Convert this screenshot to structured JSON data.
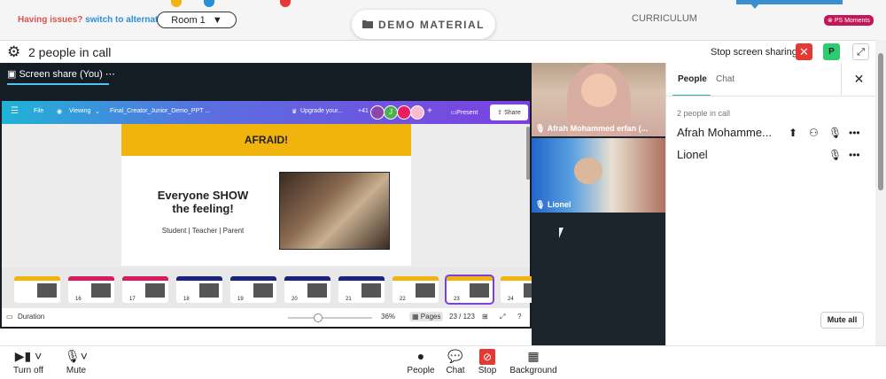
{
  "topbar": {
    "issues_text": "Having issues?",
    "switch_link": "switch to alternate room",
    "room_label": "Room 1",
    "room_caret": "▼",
    "demo_label": "DEMO MATERIAL",
    "curriculum": "CURRICULUM",
    "ps_badge": "PS Moments"
  },
  "call": {
    "title": "2 people in call",
    "stop_sharing": "Stop screen sharing",
    "avatar_initial": "P"
  },
  "share": {
    "tab_label": "Screen share (You)",
    "canva": {
      "file": "File",
      "viewing": "Viewing",
      "doc_title": "Final_Creator_Junior_Demo_PPT ...",
      "upgrade": "Upgrade your...",
      "collab_count": "+41",
      "collab_initial": "J",
      "present": "Present",
      "share": "Share"
    },
    "slide": {
      "header": "AFRAID!",
      "title": "Everyone SHOW the feeling!",
      "subtitle": "Student | Teacher | Parent"
    },
    "thumbnails": [
      {
        "num": "",
        "color": "#f0b40c"
      },
      {
        "num": "16",
        "color": "#d81b60"
      },
      {
        "num": "17",
        "color": "#d81b60"
      },
      {
        "num": "18",
        "color": "#1a237e"
      },
      {
        "num": "19",
        "color": "#1a237e"
      },
      {
        "num": "20",
        "color": "#1a237e"
      },
      {
        "num": "21",
        "color": "#1a237e"
      },
      {
        "num": "22",
        "color": "#f0b40c"
      },
      {
        "num": "23",
        "color": "#f0b40c"
      },
      {
        "num": "24",
        "color": "#f0b40c"
      }
    ],
    "footer": {
      "duration": "Duration",
      "zoom": "36%",
      "pages": "Pages",
      "page_count": "23 / 123"
    }
  },
  "videos": [
    {
      "name": "Afrah Mohammed erfan (..."
    },
    {
      "name": "Lionel"
    }
  ],
  "panel": {
    "tab_people": "People",
    "tab_chat": "Chat",
    "count_text": "2 people in call",
    "people": [
      {
        "name": "Afrah Mohamme..."
      },
      {
        "name": "Lionel"
      }
    ],
    "mute_all": "Mute all"
  },
  "controls": {
    "turn_off": "Turn off",
    "mute": "Mute",
    "people": "People",
    "chat": "Chat",
    "stop": "Stop",
    "background": "Background"
  },
  "colors": {
    "accent_teal": "#1bb8a8",
    "stop_red": "#e53935",
    "slide_yellow": "#f0b40c"
  }
}
